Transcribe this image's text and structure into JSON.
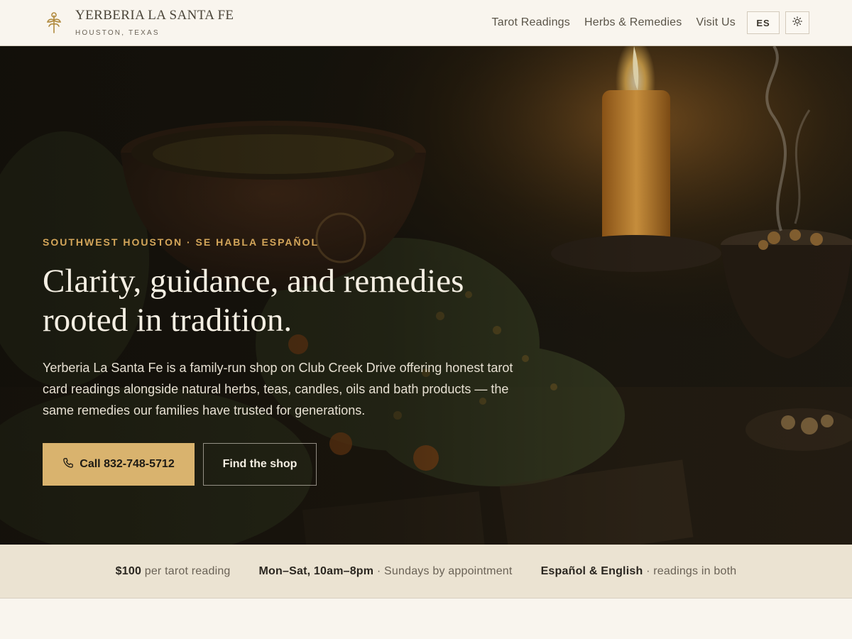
{
  "header": {
    "brand_name": "YERBERIA LA SANTA FE",
    "brand_city": "HOUSTON, TEXAS",
    "nav": [
      "Tarot Readings",
      "Herbs & Remedies",
      "Visit Us"
    ],
    "lang_label": "ES",
    "logo_icon": "herb-sprig-icon",
    "theme_icon": "sun-icon"
  },
  "hero": {
    "eyebrow": "SOUTHWEST HOUSTON · SE HABLA ESPAÑOL",
    "headline_line1": "Clarity, guidance, and remedies",
    "headline_line2": "rooted in tradition.",
    "lead": "Yerberia La Santa Fe is a family-run shop on Club Creek Drive offering honest tarot card readings alongside natural herbs, teas, candles, oils and bath products — the same remedies our families have trusted for generations.",
    "primary_cta": "Call 832-748-5712",
    "secondary_cta": "Find the shop",
    "phone_icon": "phone-icon"
  },
  "strip": {
    "items": [
      {
        "strong": "$100",
        "rest": " per tarot reading"
      },
      {
        "strong": "Mon–Sat, 10am–8pm",
        "rest": " · Sundays by appointment"
      },
      {
        "strong": "Español & English",
        "rest": " · readings in both"
      }
    ]
  },
  "colors": {
    "accent": "#d9b36e",
    "eyebrow": "#d4a65a",
    "background": "#f9f5ee",
    "strip": "#ebe3d2"
  }
}
